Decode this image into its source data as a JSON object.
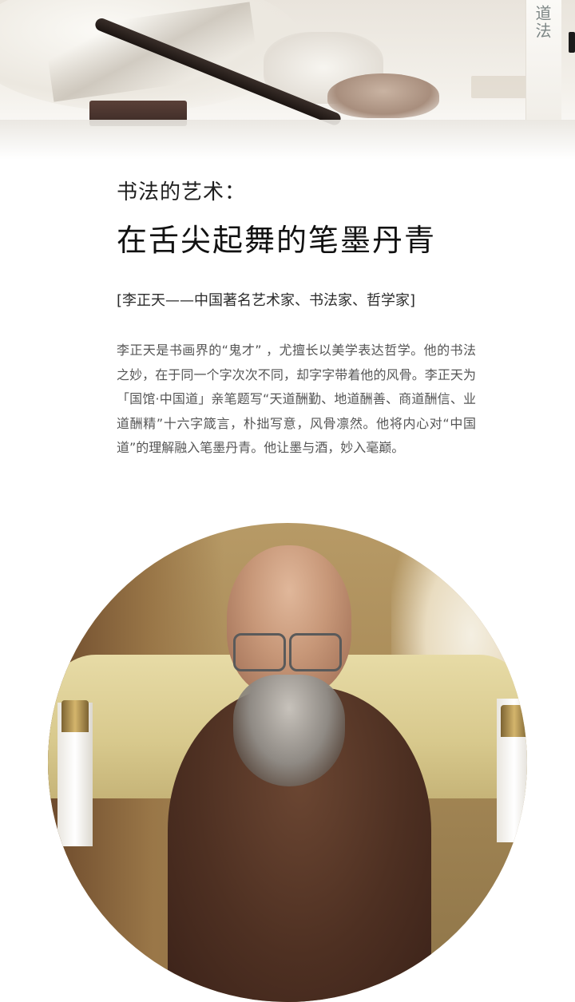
{
  "banner": {
    "scroll_text": "道法"
  },
  "heading": {
    "subtitle": "书法的艺术：",
    "title": "在舌尖起舞的笔墨丹青"
  },
  "tagline": "[李正天——中国著名艺术家、书法家、哲学家]",
  "body": "李正天是书画界的“鬼才” ，尤擅长以美学表达哲学。他的书法之妙，在于同一个字次次不同，却字字带着他的风骨。李正天为「国馆·中国道」亲笔题写“天道酬勤、地道酬善、商道酬信、业道酬精”十六字箴言，朴拙写意，风骨凛然。他将内心对“中国道”的理解融入笔墨丹青。他让墨与酒，妙入毫巅。"
}
